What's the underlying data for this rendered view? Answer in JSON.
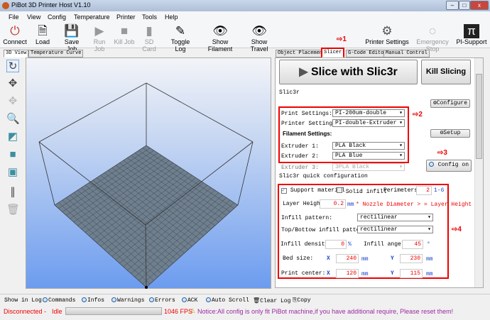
{
  "window": {
    "title": "PiBot 3D Printer Host V1.10"
  },
  "menu": [
    "File",
    "View",
    "Config",
    "Temperature",
    "Printer",
    "Tools",
    "Help"
  ],
  "toolbar": {
    "connect": "Connect",
    "load": "Load",
    "save_job": "Save Job",
    "run_job": "Run Job",
    "kill_job": "Kill Job",
    "sd_card": "SD Card",
    "toggle_log": "Toggle Log",
    "show_filament": "Show Filament",
    "show_travel": "Show Travel",
    "printer_settings": "Printer Settings",
    "emergency_stop": "Emergency Stop",
    "pi_support": "PI-Support"
  },
  "left_tabs": [
    "3D View",
    "Temperature Curve"
  ],
  "right_tabs": [
    "Object Placement",
    "Slicer",
    "G-Code Editor",
    "Manual Control"
  ],
  "annotations": [
    "1",
    "2",
    "3",
    "4"
  ],
  "slicer": {
    "slice_button": "Slice with Slic3r",
    "kill_button": "Kill Slicing",
    "group": "Slic3r",
    "configure": "Configure",
    "setup": "Setup",
    "config_on": "Config on",
    "print_settings_label": "Print Settings:",
    "print_settings": "PI-200um-double",
    "printer_settings_label": "Printer Settings:",
    "printer_settings": "PI-double-Extruder",
    "filament_label": "Filament Settings:",
    "extruder1_label": "Extruder 1:",
    "extruder1": "PLA Black",
    "extruder2_label": "Extruder 2:",
    "extruder2": "PLA Blue",
    "extruder3_label": "Extruder 3:",
    "extruder3": "3PLA Black"
  },
  "quick": {
    "group": "Slic3r quick configuration",
    "support_material": "Support material",
    "support_checked": true,
    "solid_infill": "Solid infill",
    "solid_checked": false,
    "perimeters_label": "Perimeters:",
    "perimeters": "2",
    "perimeters_range": "1-6",
    "layer_height_label": "Layer Height:",
    "layer_height": "0.2",
    "mm": "mm",
    "layer_note": "* Nozzle Diameter > = Layer Height",
    "infill_pattern_label": "Infill pattern:",
    "infill_pattern": "rectilinear",
    "topbottom_label": "Top/Bottow infill pattern:",
    "topbottom": "rectilinear",
    "infill_density_label": "Infill density",
    "infill_density": "0",
    "percent": "%",
    "infill_angle_label": "Infill angel",
    "infill_angle": "45",
    "degree": "°",
    "bed_size_label": "Bed size:",
    "x": "X",
    "y": "Y",
    "bed_x": "240",
    "bed_y": "230",
    "print_center_label": "Print center:",
    "center_x": "120",
    "center_y": "115"
  },
  "log": {
    "label": "Show in Log:",
    "options": [
      "Commands",
      "Infos",
      "Warnings",
      "Errors",
      "ACK",
      "Auto Scroll"
    ],
    "clear": "Clear Log",
    "copy": "Copy"
  },
  "status": {
    "connection": "Disconnected",
    "sep": "-",
    "state": "Idle",
    "fps": "1046 FPS",
    "notice": "Notice:All config is only fit PiBot machine,if you have additional require, Please reset them!"
  },
  "colors": {
    "accent_red": "#e00000",
    "blue_label": "#1a3fc8",
    "notice": "#9b2aa0"
  }
}
